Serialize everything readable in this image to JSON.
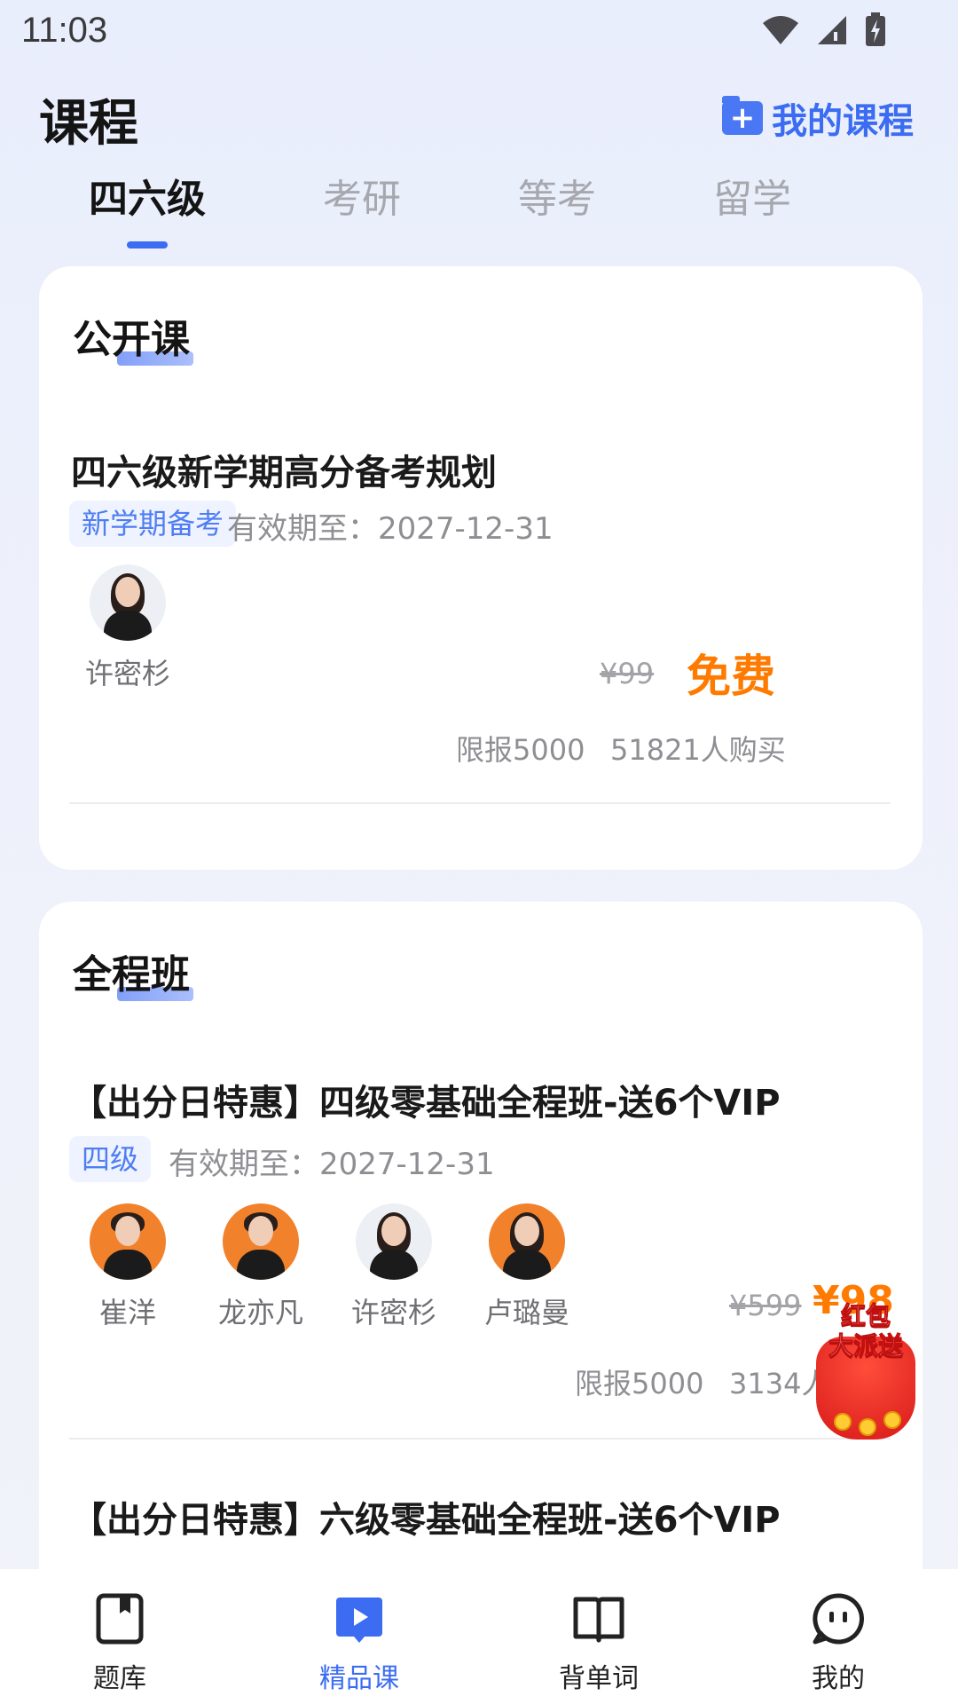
{
  "status_bar": {
    "time": "11:03"
  },
  "header": {
    "title": "课程",
    "my_courses": "我的课程"
  },
  "tabs": [
    {
      "label": "四六级",
      "active": true
    },
    {
      "label": "考研",
      "active": false
    },
    {
      "label": "等考",
      "active": false
    },
    {
      "label": "留学",
      "active": false
    }
  ],
  "sections": [
    {
      "title": "公开课",
      "courses": [
        {
          "title": "四六级新学期高分备考规划",
          "tag": "新学期备考",
          "validity": "有效期至：2027-12-31",
          "teachers": [
            "许密杉"
          ],
          "old_price": "¥99",
          "price": "免费",
          "limit": "限报5000",
          "buyers": "51821人购买"
        }
      ]
    },
    {
      "title": "全程班",
      "courses": [
        {
          "title": "【出分日特惠】四级零基础全程班-送6个VIP",
          "tag": "四级",
          "validity": "有效期至：2027-12-31",
          "teachers": [
            "崔洋",
            "龙亦凡",
            "许密杉",
            "卢璐曼"
          ],
          "old_price": "¥599",
          "price": "¥98",
          "limit": "限报5000",
          "buyers": "3134人"
        },
        {
          "title": "【出分日特惠】六级零基础全程班-送6个VIP"
        }
      ]
    }
  ],
  "promo": {
    "line1": "红包",
    "line2": "大派送"
  },
  "bottom_nav": [
    {
      "label": "题库",
      "icon": "bookmark-book-icon",
      "active": false
    },
    {
      "label": "精品课",
      "icon": "play-icon",
      "active": true
    },
    {
      "label": "背单词",
      "icon": "open-book-icon",
      "active": false
    },
    {
      "label": "我的",
      "icon": "chat-face-icon",
      "active": false
    }
  ],
  "colors": {
    "accent": "#3b6cf2",
    "price": "#ff7a00",
    "tag_bg": "#eef3ff"
  }
}
